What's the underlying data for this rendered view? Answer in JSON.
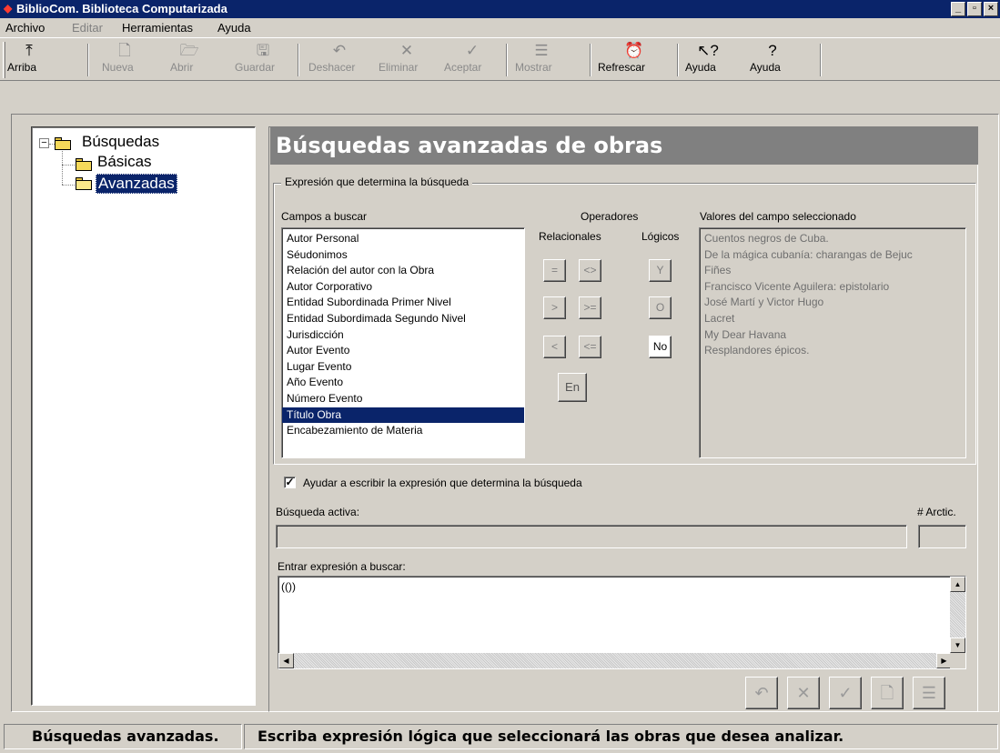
{
  "window": {
    "title": "BiblioCom. Biblioteca Computarizada",
    "controls": {
      "minimize": "_",
      "maximize": "▫",
      "close": "×"
    }
  },
  "menu": [
    {
      "label": "Archivo",
      "enabled": true
    },
    {
      "label": "Editar",
      "enabled": false
    },
    {
      "label": "Herramientas",
      "enabled": true
    },
    {
      "label": "Ayuda",
      "enabled": true
    }
  ],
  "toolbar": [
    {
      "label": "Arriba",
      "icon": "up-folder-icon",
      "glyph": "⤒",
      "enabled": true
    },
    {
      "label": "Nueva",
      "icon": "new-document-icon",
      "glyph": "🗋",
      "enabled": false
    },
    {
      "label": "Abrir",
      "icon": "open-folder-icon",
      "glyph": "🗁",
      "enabled": false
    },
    {
      "label": "Guardar",
      "icon": "save-disk-icon",
      "glyph": "🖫",
      "enabled": false
    },
    {
      "label": "Deshacer",
      "icon": "undo-icon",
      "glyph": "↶",
      "enabled": false
    },
    {
      "label": "Eliminar",
      "icon": "delete-x-icon",
      "glyph": "✕",
      "enabled": false
    },
    {
      "label": "Aceptar",
      "icon": "check-icon",
      "glyph": "✓",
      "enabled": false
    },
    {
      "label": "Mostrar",
      "icon": "show-report-icon",
      "glyph": "☰",
      "enabled": false
    },
    {
      "label": "Refrescar",
      "icon": "alarm-clock-icon",
      "glyph": "⏰",
      "enabled": true
    },
    {
      "label": "Ayuda",
      "icon": "help-pointer-icon",
      "glyph": "↖?",
      "enabled": true
    },
    {
      "label": "Ayuda",
      "icon": "help-question-icon",
      "glyph": "?",
      "enabled": true
    }
  ],
  "tree": {
    "root": "Búsquedas",
    "children": [
      {
        "label": "Básicas",
        "selected": false
      },
      {
        "label": "Avanzadas",
        "selected": true
      }
    ]
  },
  "panel": {
    "header": "Búsquedas avanzadas de obras",
    "group_title": "Expresión que determina la búsqueda",
    "fields_label": "Campos a buscar",
    "operators_label": "Operadores",
    "relational_label": "Relacionales",
    "logical_label": "Lógicos",
    "values_label": "Valores del campo seleccionado",
    "fields": [
      "Autor Personal",
      "Séudonimos",
      "Relación del autor con la Obra",
      "Autor Corporativo",
      "Entidad Subordinada Primer Nivel",
      "Entidad Subordimada Segundo Nivel",
      "Jurisdicción",
      "Autor Evento",
      "Lugar Evento",
      "Año Evento",
      "Número Evento",
      "Título Obra",
      "Encabezamiento de Materia"
    ],
    "selected_field": "Título Obra",
    "relational_ops": [
      "=",
      "<>",
      ">",
      ">=",
      "<",
      "<="
    ],
    "logical_ops": [
      "Y",
      "O",
      "No"
    ],
    "en_op": "En",
    "values": [
      "Cuentos negros de Cuba.",
      "De la mágica cubanía: charangas de Bejuc",
      "Fiñes",
      "Francisco Vicente Aguilera: epistolario",
      "José Martí y Victor Hugo",
      "Lacret",
      "My Dear Havana",
      "Resplandores épicos."
    ],
    "help_checkbox_label": "Ayudar a escribir la expresión que determina la búsqueda",
    "help_checked": true,
    "active_search_label": "Búsqueda activa:",
    "active_search_value": "",
    "count_label": "# Arctic.",
    "count_value": "",
    "enter_expr_label": "Entrar expresión a buscar:",
    "expr_value": "(())"
  },
  "action_buttons": [
    {
      "icon": "undo-icon",
      "glyph": "↶"
    },
    {
      "icon": "delete-x-icon",
      "glyph": "✕"
    },
    {
      "icon": "check-icon",
      "glyph": "✓"
    },
    {
      "icon": "new-document-icon",
      "glyph": "🗋"
    },
    {
      "icon": "show-report-icon",
      "glyph": "☰"
    }
  ],
  "status": {
    "left": "Búsquedas avanzadas.",
    "right": "Escriba expresión lógica que seleccionará las obras que desea analizar."
  }
}
